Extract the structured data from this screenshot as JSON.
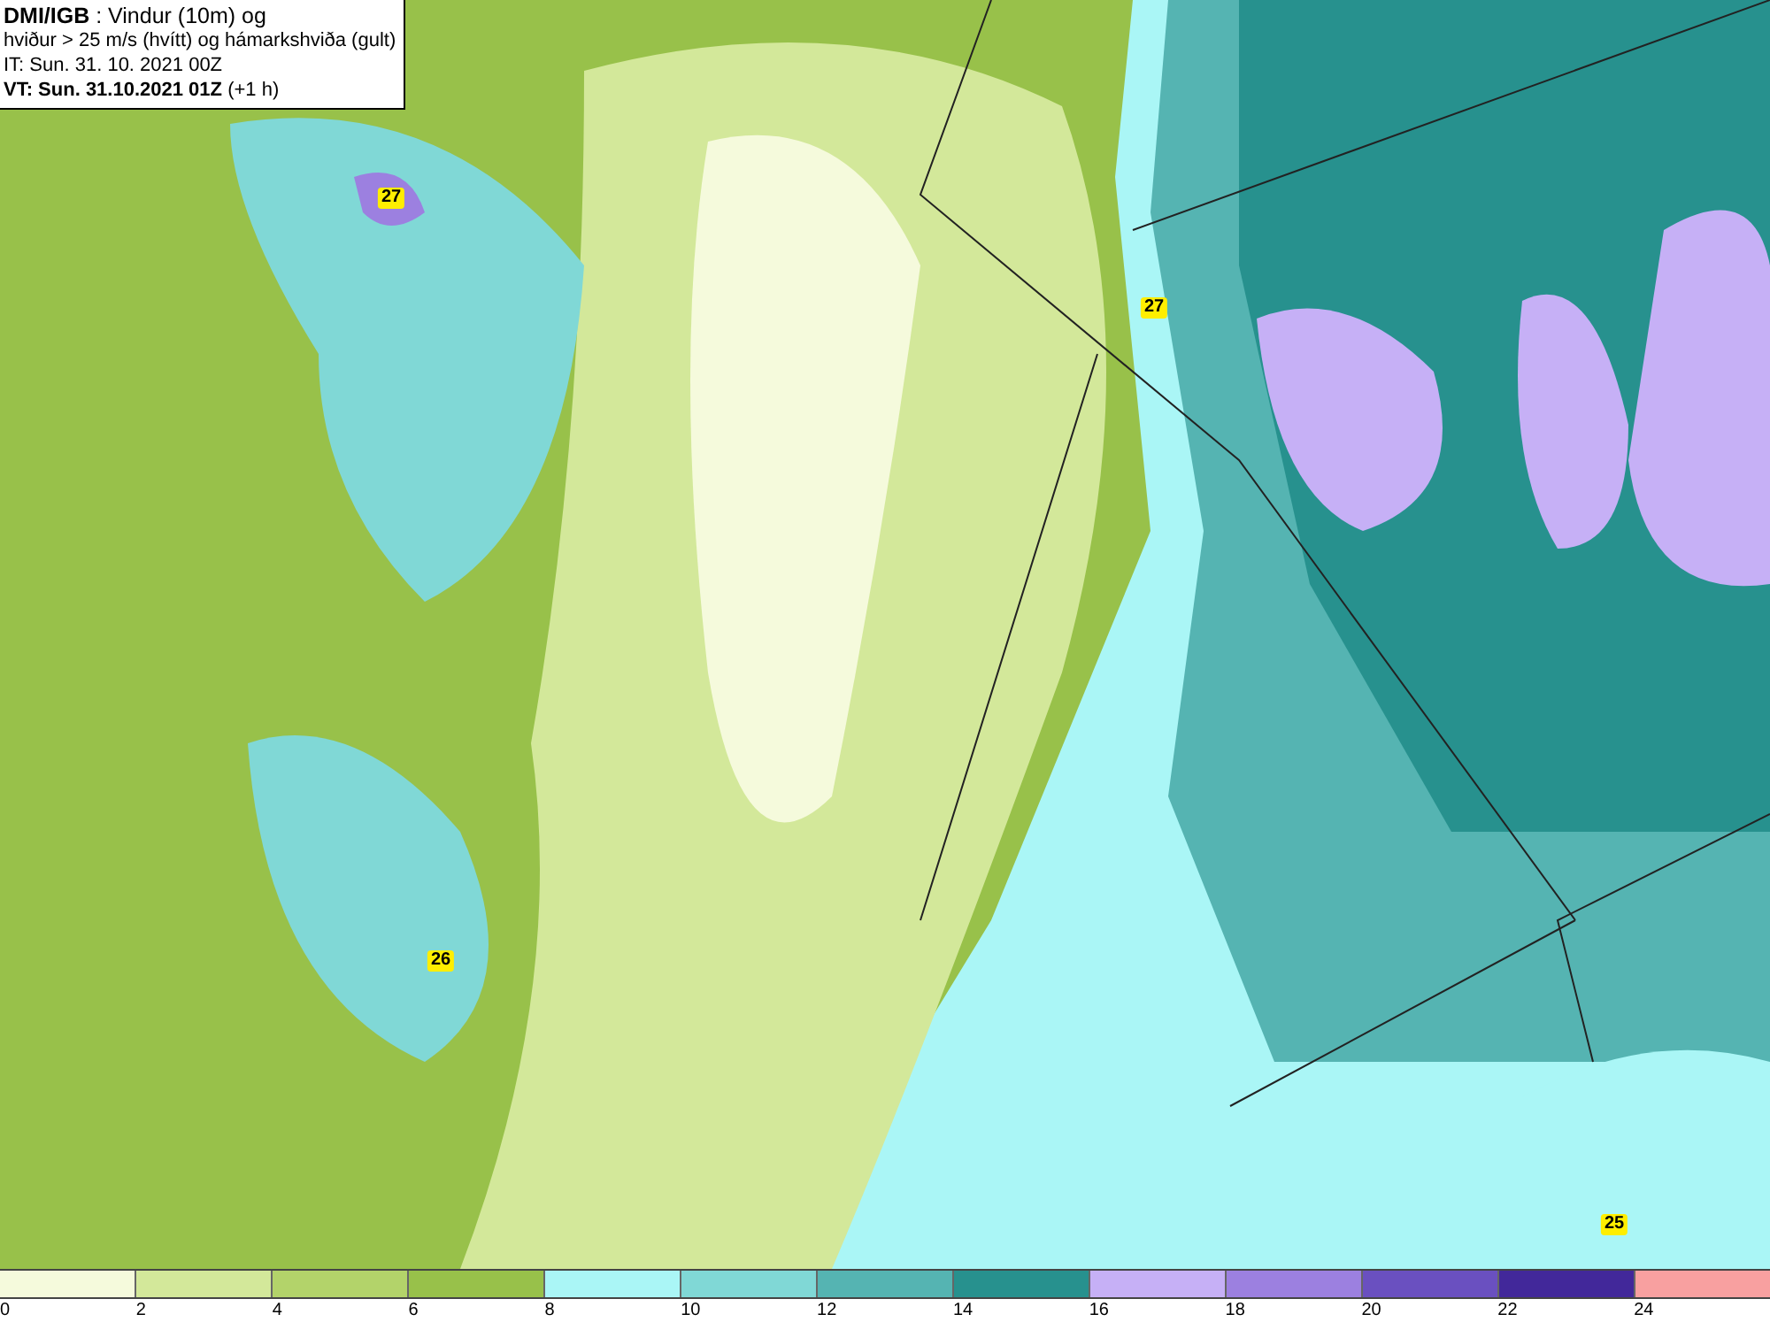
{
  "header": {
    "lines": [
      "**DMI/IGB** : Vindur (10m) og",
      "hviður > 25 m/s (hvítt) og hámarkshviða (gult)",
      "IT: Sun. 31. 10. 2021 00Z",
      "**VT: Sun. 31.10.2021 01Z** (+1 h)"
    ]
  },
  "map": {
    "gust_labels": [
      "27",
      "27",
      "26",
      "25"
    ]
  },
  "colorbar": {
    "segments": [
      {
        "color": "#f5fadc"
      },
      {
        "color": "#d3e89a"
      },
      {
        "color": "#b3d36a"
      },
      {
        "color": "#98c14a"
      },
      {
        "color": "#aaf6f6"
      },
      {
        "color": "#80d8d6"
      },
      {
        "color": "#55b4b2"
      },
      {
        "color": "#27918e"
      },
      {
        "color": "#c6b0f6"
      },
      {
        "color": "#9c80e0"
      },
      {
        "color": "#6a50c0"
      },
      {
        "color": "#42289a"
      },
      {
        "color": "#f8a0a0"
      }
    ],
    "ticks": [
      "0",
      "2",
      "4",
      "6",
      "8",
      "10",
      "12",
      "14",
      "16",
      "18",
      "20",
      "22",
      "24"
    ]
  }
}
